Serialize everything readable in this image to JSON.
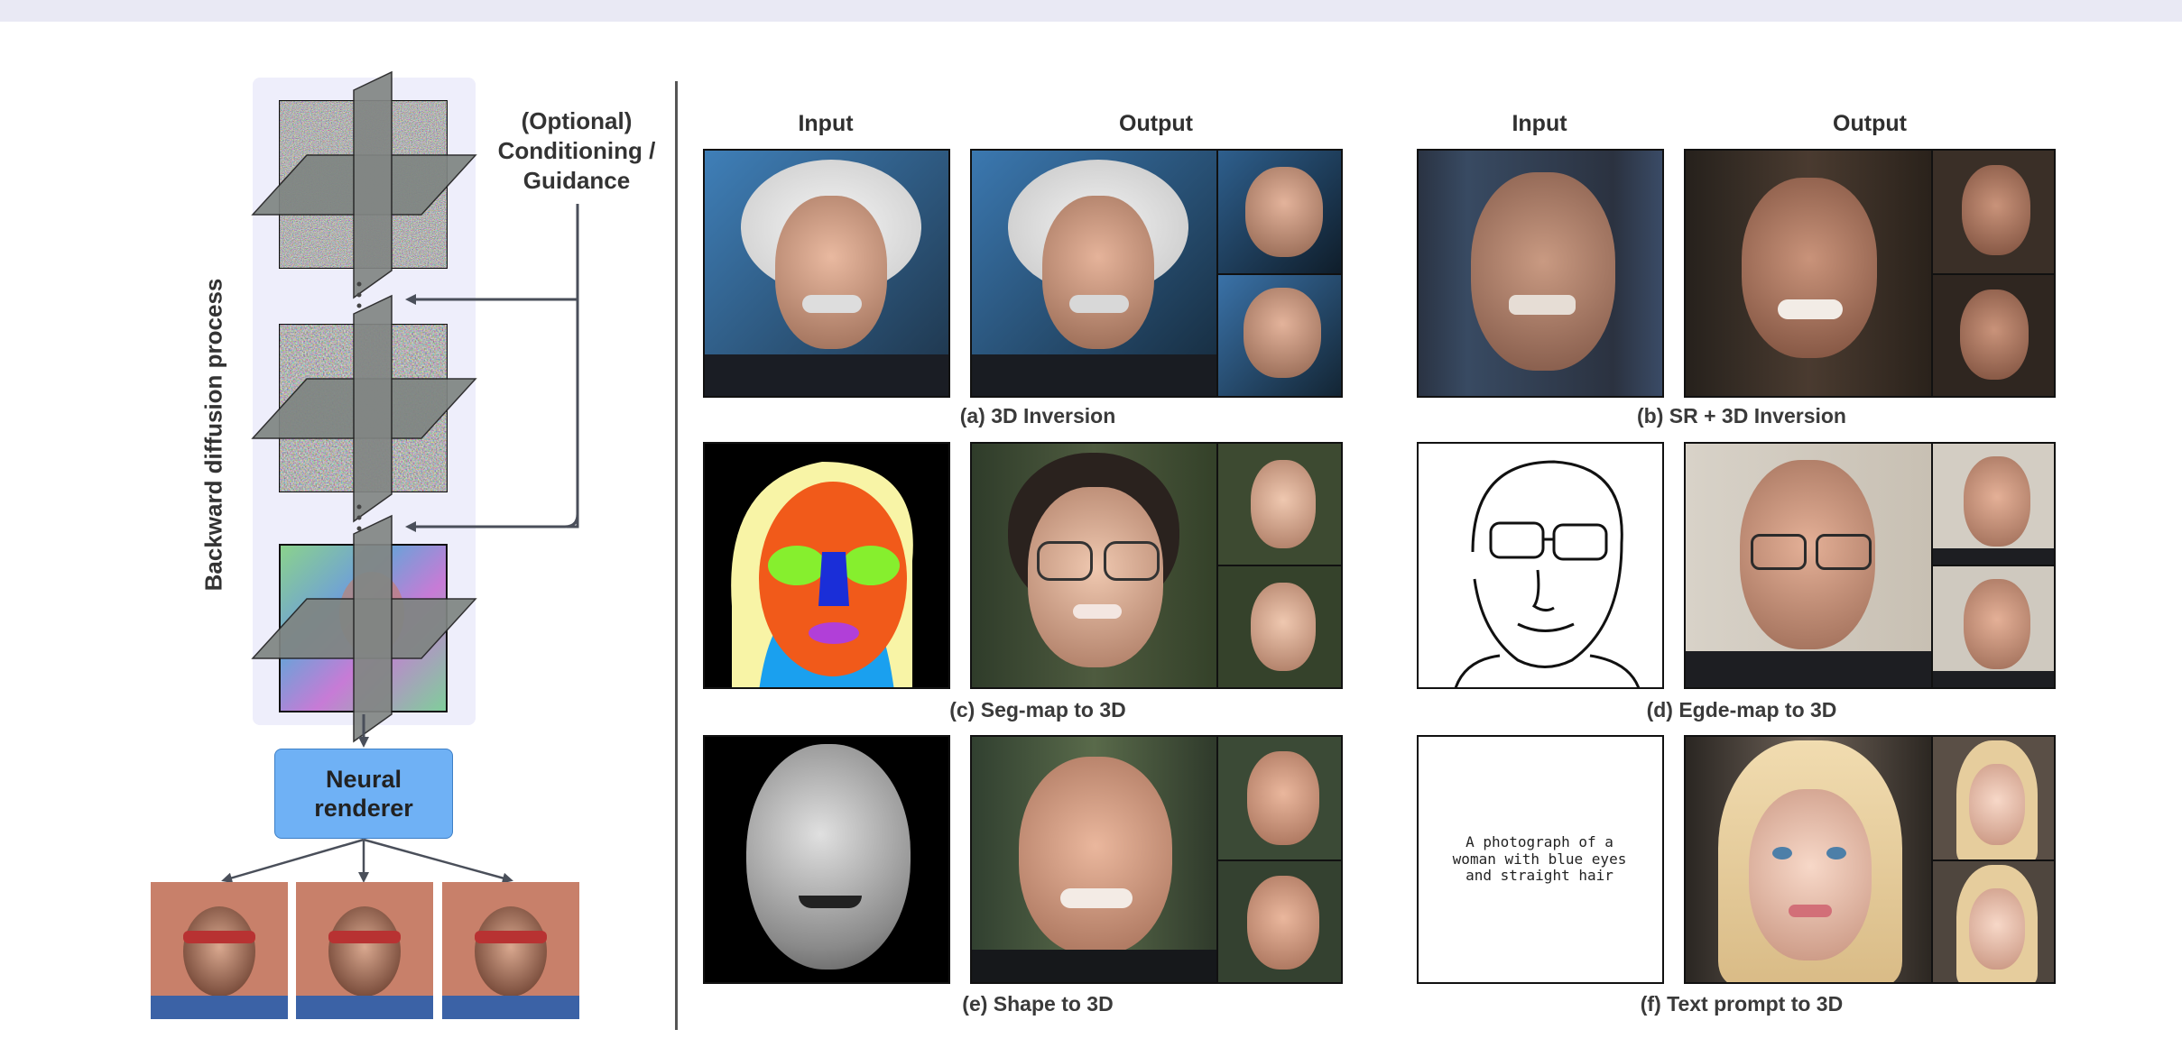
{
  "labels": {
    "input": "Input",
    "output": "Output",
    "guidance_line1": "(Optional)",
    "guidance_line2": "Conditioning /",
    "guidance_line3": "Guidance",
    "process": "Backward diffusion process",
    "renderer_line1": "Neural",
    "renderer_line2": "renderer"
  },
  "captions": {
    "a": "(a) 3D Inversion",
    "b": "(b) SR + 3D Inversion",
    "c": "(c) Seg-map to 3D",
    "d": "(d) Egde-map to 3D",
    "e": "(e) Shape to 3D",
    "f": "(f) Text prompt to 3D"
  },
  "prompt": {
    "line1": "A photograph of a",
    "line2": "woman with blue eyes",
    "line3": "and straight hair"
  },
  "colors": {
    "panel": "#eeeefb",
    "renderer": "#6fb1f5",
    "arrow": "#4a4f5a"
  }
}
